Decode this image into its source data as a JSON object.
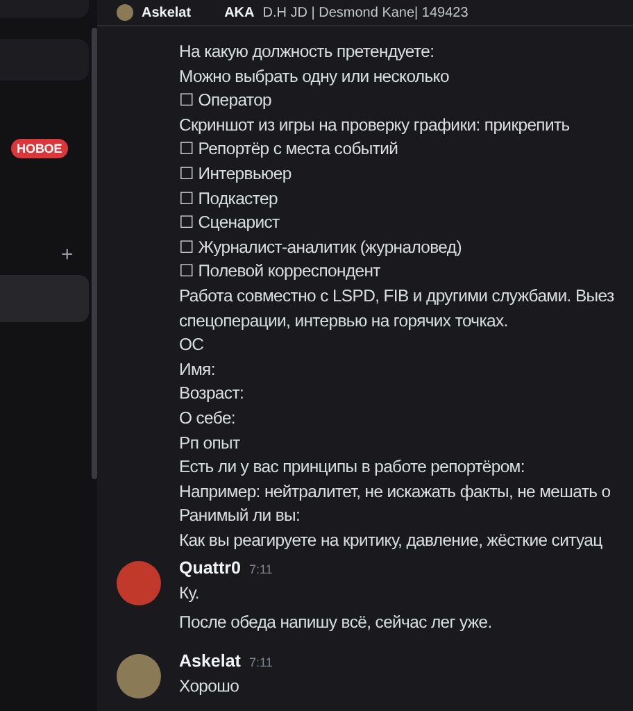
{
  "sidebar": {
    "new_badge": "НОВОЕ",
    "add_button": "+",
    "items": [
      {
        "selected": false
      },
      {
        "selected": true
      }
    ]
  },
  "header": {
    "author": "Askelat",
    "tag": "AKA",
    "text": "D.H JD | Desmond Kane| 149423"
  },
  "continued_lines": [
    "На какую должность претендуете:",
    "Можно выбрать одну или несколько",
    "☐ Оператор",
    "Скриншот из игры на проверку графики: прикрепить",
    "☐ Репортёр с места событий",
    "☐ Интервьюер",
    "☐ Подкастер",
    "☐ Сценарист",
    "☐ Журналист-аналитик (журналовед)",
    "☐ Полевой корреспондент",
    "Работа совместно с LSPD, FIB и другими службами. Выез",
    "спецоперации, интервью на горячих точках.",
    "ОС",
    "Имя:",
    "Возраст:",
    "О себе:",
    "Рп опыт",
    "Есть ли у вас принципы в работе репортёром:",
    "Например: нейтралитет, не искажать факты, не мешать о",
    "Ранимый ли вы:",
    "Как вы реагируете на критику, давление, жёсткие ситуац"
  ],
  "messages": [
    {
      "author": "Quattr0",
      "time": "7:11",
      "color": "#c0392b",
      "lines": [
        "Ку.",
        "После обеда напишу всё, сейчас лег уже."
      ]
    },
    {
      "author": "Askelat",
      "time": "7:11",
      "color": "#8a7a55",
      "lines": [
        "Хорошо"
      ]
    }
  ]
}
